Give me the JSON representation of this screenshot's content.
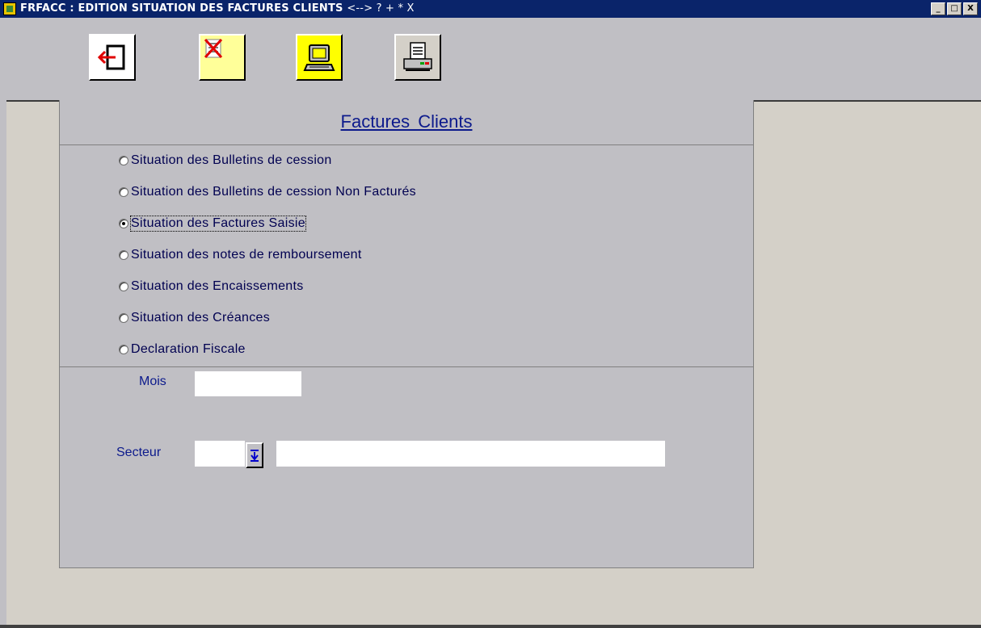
{
  "window": {
    "title": "FRFACC : EDITION SITUATION DES FACTURES CLIENTS",
    "title_suffix": "<--> ? + * X",
    "controls": [
      "_",
      "□",
      "X"
    ]
  },
  "toolbar": {
    "buttons": [
      {
        "name": "exit-button",
        "icon": "exit-door-icon",
        "bg": "#ffffff"
      },
      {
        "name": "cancel-button",
        "icon": "crossed-document-icon",
        "bg": "#ffff99"
      },
      {
        "name": "screen-preview-button",
        "icon": "computer-monitor-icon",
        "bg": "#ffff00"
      },
      {
        "name": "print-button",
        "icon": "printer-icon",
        "bg": "#d4d0c8"
      }
    ]
  },
  "panel": {
    "heading": "Factures  Clients",
    "options": [
      {
        "label": "Situation des Bulletins de cession",
        "checked": false
      },
      {
        "label": "Situation des Bulletins de cession Non Facturés",
        "checked": false
      },
      {
        "label": "Situation des Factures Saisie",
        "checked": true
      },
      {
        "label": "Situation des notes de remboursement",
        "checked": false
      },
      {
        "label": "Situation des Encaissements",
        "checked": false
      },
      {
        "label": "Situation des Créances",
        "checked": false
      },
      {
        "label": "Declaration Fiscale",
        "checked": false
      }
    ],
    "fields": {
      "mois_label": "Mois",
      "mois_value": "",
      "secteur_label": "Secteur",
      "secteur_code": "",
      "secteur_name": ""
    }
  },
  "colors": {
    "titlebar": "#0a246a",
    "heading": "#0c1a8c",
    "panel_bg": "#c0bfc4",
    "desktop_bg": "#d4d0c8"
  }
}
